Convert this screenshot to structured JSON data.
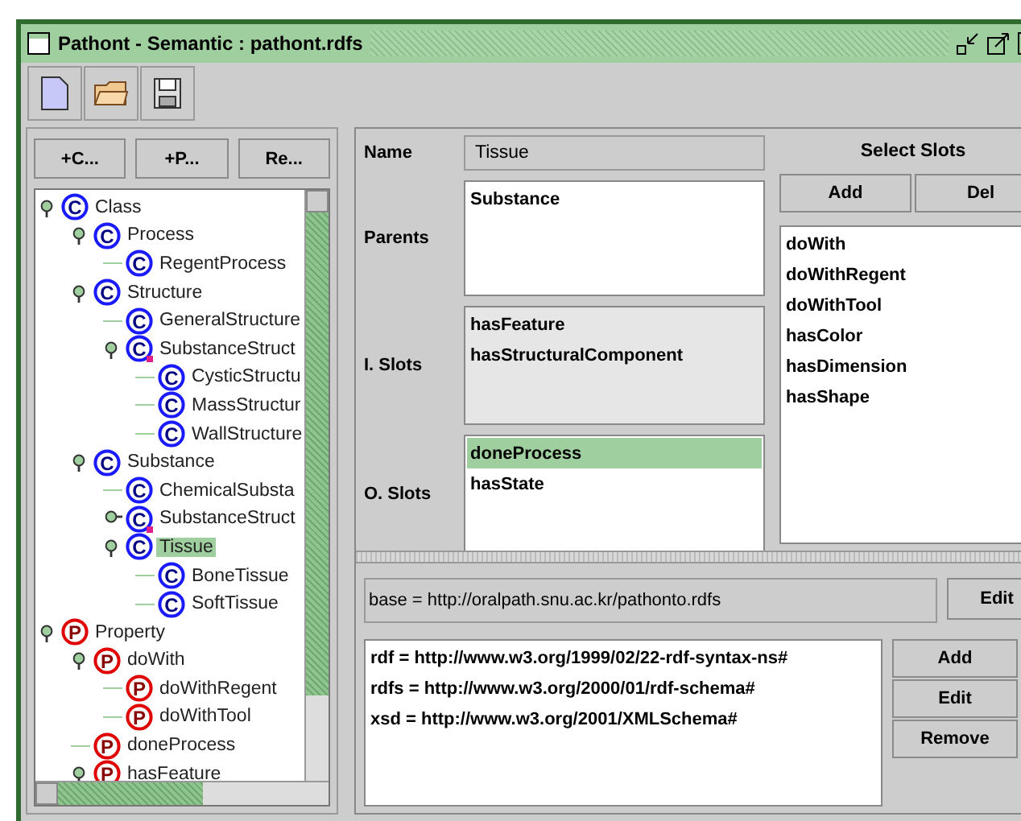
{
  "window": {
    "title": "Pathont - Semantic : pathont.rdfs"
  },
  "tree_buttons": [
    "+C...",
    "+P...",
    "Re..."
  ],
  "tree": [
    {
      "label": "Class",
      "kind": "class",
      "icon": "C",
      "selected": false,
      "expanded": true,
      "children": [
        {
          "label": "Process",
          "kind": "class",
          "icon": "C",
          "selected": false,
          "expanded": true,
          "children": [
            {
              "label": "RegentProcess",
              "kind": "class",
              "icon": "C",
              "selected": false
            }
          ]
        },
        {
          "label": "Structure",
          "kind": "class",
          "icon": "C",
          "selected": false,
          "expanded": true,
          "children": [
            {
              "label": "GeneralStructure",
              "kind": "class",
              "icon": "C",
              "selected": false
            },
            {
              "label": "SubstanceStruct",
              "kind": "class",
              "icon": "C",
              "selected": false,
              "marked": true,
              "expanded": true,
              "children": [
                {
                  "label": "CysticStructu",
                  "kind": "class",
                  "icon": "C",
                  "selected": false
                },
                {
                  "label": "MassStructur",
                  "kind": "class",
                  "icon": "C",
                  "selected": false
                },
                {
                  "label": "WallStructure",
                  "kind": "class",
                  "icon": "C",
                  "selected": false
                }
              ]
            }
          ]
        },
        {
          "label": "Substance",
          "kind": "class",
          "icon": "C",
          "selected": false,
          "expanded": true,
          "children": [
            {
              "label": "ChemicalSubsta",
              "kind": "class",
              "icon": "C",
              "selected": false
            },
            {
              "label": "SubstanceStruct",
              "kind": "class",
              "icon": "C",
              "selected": false,
              "marked": true,
              "expanded": false
            },
            {
              "label": "Tissue",
              "kind": "class",
              "icon": "C",
              "selected": true,
              "expanded": true,
              "children": [
                {
                  "label": "BoneTissue",
                  "kind": "class",
                  "icon": "C",
                  "selected": false
                },
                {
                  "label": "SoftTissue",
                  "kind": "class",
                  "icon": "C",
                  "selected": false
                }
              ]
            }
          ]
        }
      ]
    },
    {
      "label": "Property",
      "kind": "property",
      "icon": "P",
      "selected": false,
      "expanded": true,
      "children": [
        {
          "label": "doWith",
          "kind": "property",
          "icon": "P",
          "selected": false,
          "expanded": true,
          "children": [
            {
              "label": "doWithRegent",
              "kind": "property",
              "icon": "P",
              "selected": false
            },
            {
              "label": "doWithTool",
              "kind": "property",
              "icon": "P",
              "selected": false
            }
          ]
        },
        {
          "label": "doneProcess",
          "kind": "property",
          "icon": "P",
          "selected": false
        },
        {
          "label": "hasFeature",
          "kind": "property",
          "icon": "P",
          "selected": false,
          "expanded": true
        }
      ]
    }
  ],
  "form": {
    "name_label": "Name",
    "name_value": "Tissue",
    "parents_label": "Parents",
    "i_slots_label": "I. Slots",
    "o_slots_label": "O. Slots",
    "parents": [
      {
        "label": "Substance",
        "selected": false
      }
    ],
    "i_slots": [
      {
        "label": "hasFeature",
        "selected": false
      },
      {
        "label": "hasStructuralComponent",
        "selected": false
      }
    ],
    "o_slots": [
      {
        "label": "doneProcess",
        "selected": true
      },
      {
        "label": "hasState",
        "selected": false
      }
    ]
  },
  "select_slots": {
    "title": "Select Slots",
    "buttons": [
      "Add",
      "Del"
    ],
    "items": [
      {
        "label": "doWith",
        "selected": false
      },
      {
        "label": "doWithRegent",
        "selected": false
      },
      {
        "label": "doWithTool",
        "selected": false
      },
      {
        "label": "hasColor",
        "selected": false
      },
      {
        "label": "hasDimension",
        "selected": false
      },
      {
        "label": "hasShape",
        "selected": false
      }
    ]
  },
  "namespaces": {
    "base": "base = http://oralpath.snu.ac.kr/pathonto.rdfs",
    "base_button": "Edit",
    "items": [
      {
        "label": "rdf = http://www.w3.org/1999/02/22-rdf-syntax-ns#",
        "selected": false
      },
      {
        "label": "rdfs = http://www.w3.org/2000/01/rdf-schema#",
        "selected": false
      },
      {
        "label": "xsd = http://www.w3.org/2001/XMLSchema#",
        "selected": false
      }
    ],
    "buttons": [
      "Add",
      "Edit",
      "Remove"
    ]
  }
}
